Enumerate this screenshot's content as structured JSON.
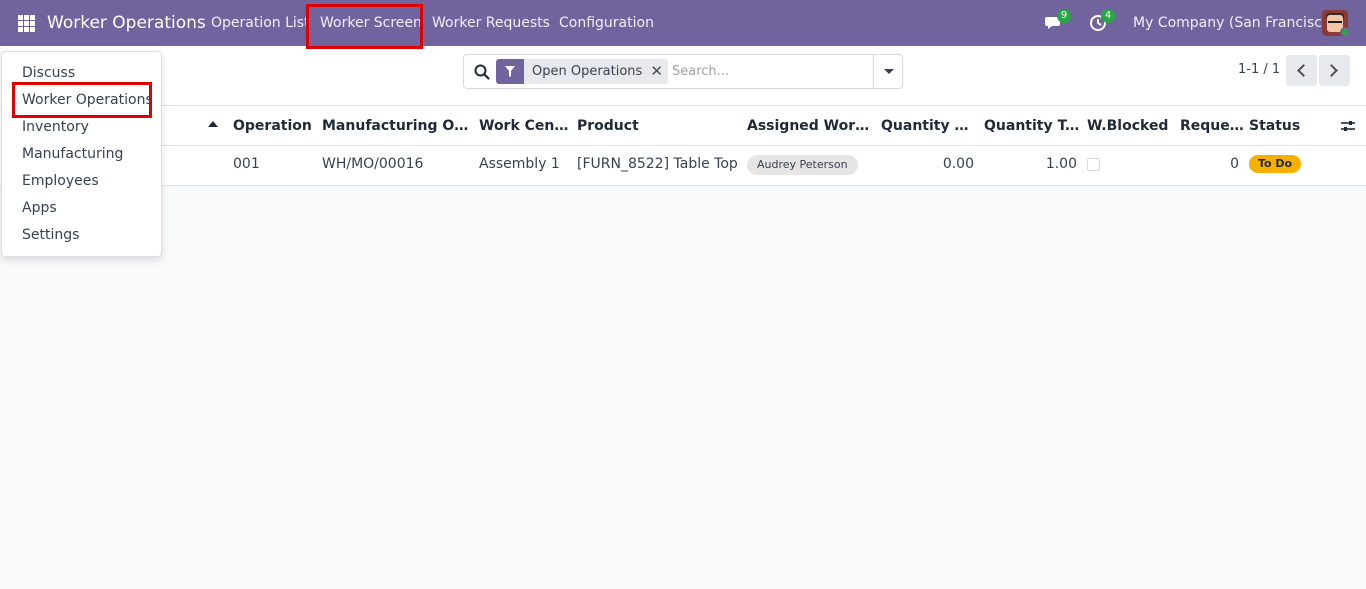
{
  "navbar": {
    "brand": "Worker Operations",
    "menu": [
      "Operation List",
      "Worker Screen",
      "Worker Requests",
      "Configuration"
    ],
    "messages_count": "9",
    "activities_count": "4",
    "company": "My Company (San Francisco)"
  },
  "apps_dropdown": {
    "items": [
      "Discuss",
      "Worker Operations",
      "Inventory",
      "Manufacturing",
      "Employees",
      "Apps",
      "Settings"
    ]
  },
  "search": {
    "facet_label": "Open Operations",
    "placeholder": "Search..."
  },
  "pager": {
    "value": "1-1 / 1"
  },
  "table": {
    "columns": [
      "Operation",
      "Manufacturing Order",
      "Work Center",
      "Product",
      "Assigned Workers",
      "Quantity Do...",
      "Quantity To ...",
      "W.Blocked",
      "Requests",
      "Status"
    ],
    "rows": [
      {
        "operation": "001",
        "manufacturing_order": "WH/MO/00016",
        "work_center": "Assembly 1",
        "product": "[FURN_8522] Table Top",
        "assigned_worker": "Audrey Peterson",
        "quantity_done": "0.00",
        "quantity_to_do": "1.00",
        "w_blocked": false,
        "requests": "0",
        "status": "To Do"
      }
    ]
  },
  "colors": {
    "navbar": "#71639e",
    "highlight": "#e00000",
    "status_todo": "#f5b000",
    "badge": "#28a745"
  }
}
